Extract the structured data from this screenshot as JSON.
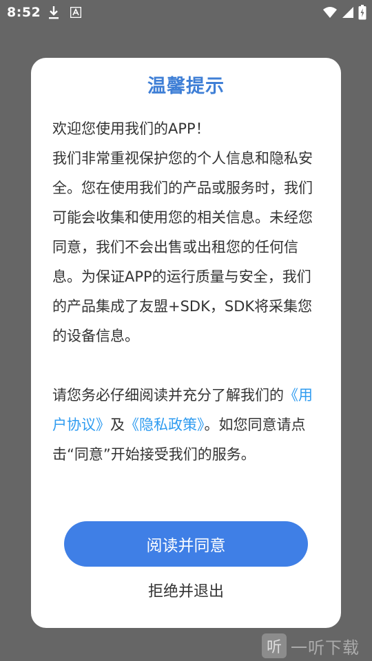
{
  "status_bar": {
    "time": "8:52",
    "icons": [
      "download-icon",
      "a-notification-icon",
      "wifi-icon",
      "cellular-signal-icon",
      "battery-charging-icon"
    ]
  },
  "dialog": {
    "title": "温馨提示",
    "paragraph1": {
      "line1": "欢迎您使用我们的APP！",
      "text": "我们非常重视保护您的个人信息和隐私安全。您在使用我们的产品或服务时，我们可能会收集和使用您的相关信息。未经您同意，我们不会出售或出租您的任何信息。为保证APP的运行质量与安全，我们的产品集成了友盟+SDK，SDK将采集您的设备信息。"
    },
    "paragraph2": {
      "prefix": "请您务必仔细阅读并充分了解我们的",
      "user_agreement_link": "《用户协议》",
      "conjunction": "及",
      "privacy_policy_link": "《隐私政策》",
      "suffix": "。如您同意请点击“同意”开始接受我们的服务。"
    },
    "agree_button_label": "阅读并同意",
    "reject_button_label": "拒绝并退出"
  },
  "watermark": {
    "logo_char": "听",
    "text": "一听下载"
  },
  "colors": {
    "overlay": "#666666",
    "title": "#3f7fd6",
    "link": "#2e9bf0",
    "button": "#3f7fe6"
  }
}
